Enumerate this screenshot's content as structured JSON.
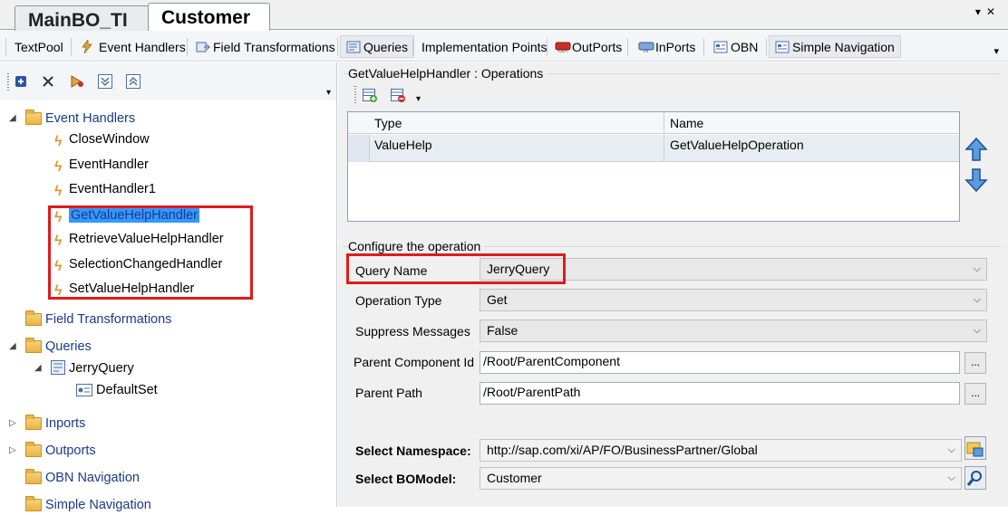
{
  "doc_tabs": {
    "inactive": "MainBO_TI",
    "active": "Customer"
  },
  "toolbar": {
    "items": [
      {
        "label": "TextPool",
        "icon": "none"
      },
      {
        "label": "Event Handlers",
        "icon": "lightning-icon"
      },
      {
        "label": "Field Transformations",
        "icon": "transform-icon"
      },
      {
        "label": "Queries",
        "icon": "query-icon"
      },
      {
        "label": "Implementation Points",
        "icon": "none"
      },
      {
        "label": "OutPorts",
        "icon": "outport-icon"
      },
      {
        "label": "InPorts",
        "icon": "inport-icon"
      },
      {
        "label": "OBN",
        "icon": "obn-icon"
      },
      {
        "label": "Simple Navigation",
        "icon": "navigation-icon"
      }
    ]
  },
  "tree": {
    "event_handlers": {
      "label": "Event Handlers",
      "children": [
        "CloseWindow",
        "EventHandler",
        "EventHandler1",
        "GetValueHelpHandler",
        "RetrieveValueHelpHandler",
        "SelectionChangedHandler",
        "SetValueHelpHandler"
      ]
    },
    "field_transformations": "Field Transformations",
    "queries": {
      "label": "Queries",
      "query": "JerryQuery",
      "set": "DefaultSet"
    },
    "inports": "Inports",
    "outports": "Outports",
    "obn_navigation": "OBN Navigation",
    "simple_navigation": "Simple Navigation"
  },
  "operations": {
    "title": "GetValueHelpHandler : Operations",
    "columns": [
      "Type",
      "Name"
    ],
    "rows": [
      {
        "type": "ValueHelp",
        "name": "GetValueHelpOperation"
      }
    ]
  },
  "configure": {
    "title": "Configure the operation",
    "query_name_label": "Query Name",
    "query_name_value": "JerryQuery",
    "operation_type_label": "Operation Type",
    "operation_type_value": "Get",
    "suppress_label": "Suppress Messages",
    "suppress_value": "False",
    "parent_component_label": "Parent Component Id",
    "parent_component_value": "/Root/ParentComponent",
    "parent_path_label": "Parent Path",
    "parent_path_value": "/Root/ParentPath",
    "ellipsis": "...",
    "namespace_label": "Select Namespace:",
    "namespace_value": "http://sap.com/xi/AP/FO/BusinessPartner/Global",
    "bomodel_label": "Select BOModel:",
    "bomodel_value": "Customer"
  },
  "colors": {
    "accent_red": "#e01b1b",
    "selection_blue": "#3399ff",
    "link_blue": "#1a3a8a"
  }
}
